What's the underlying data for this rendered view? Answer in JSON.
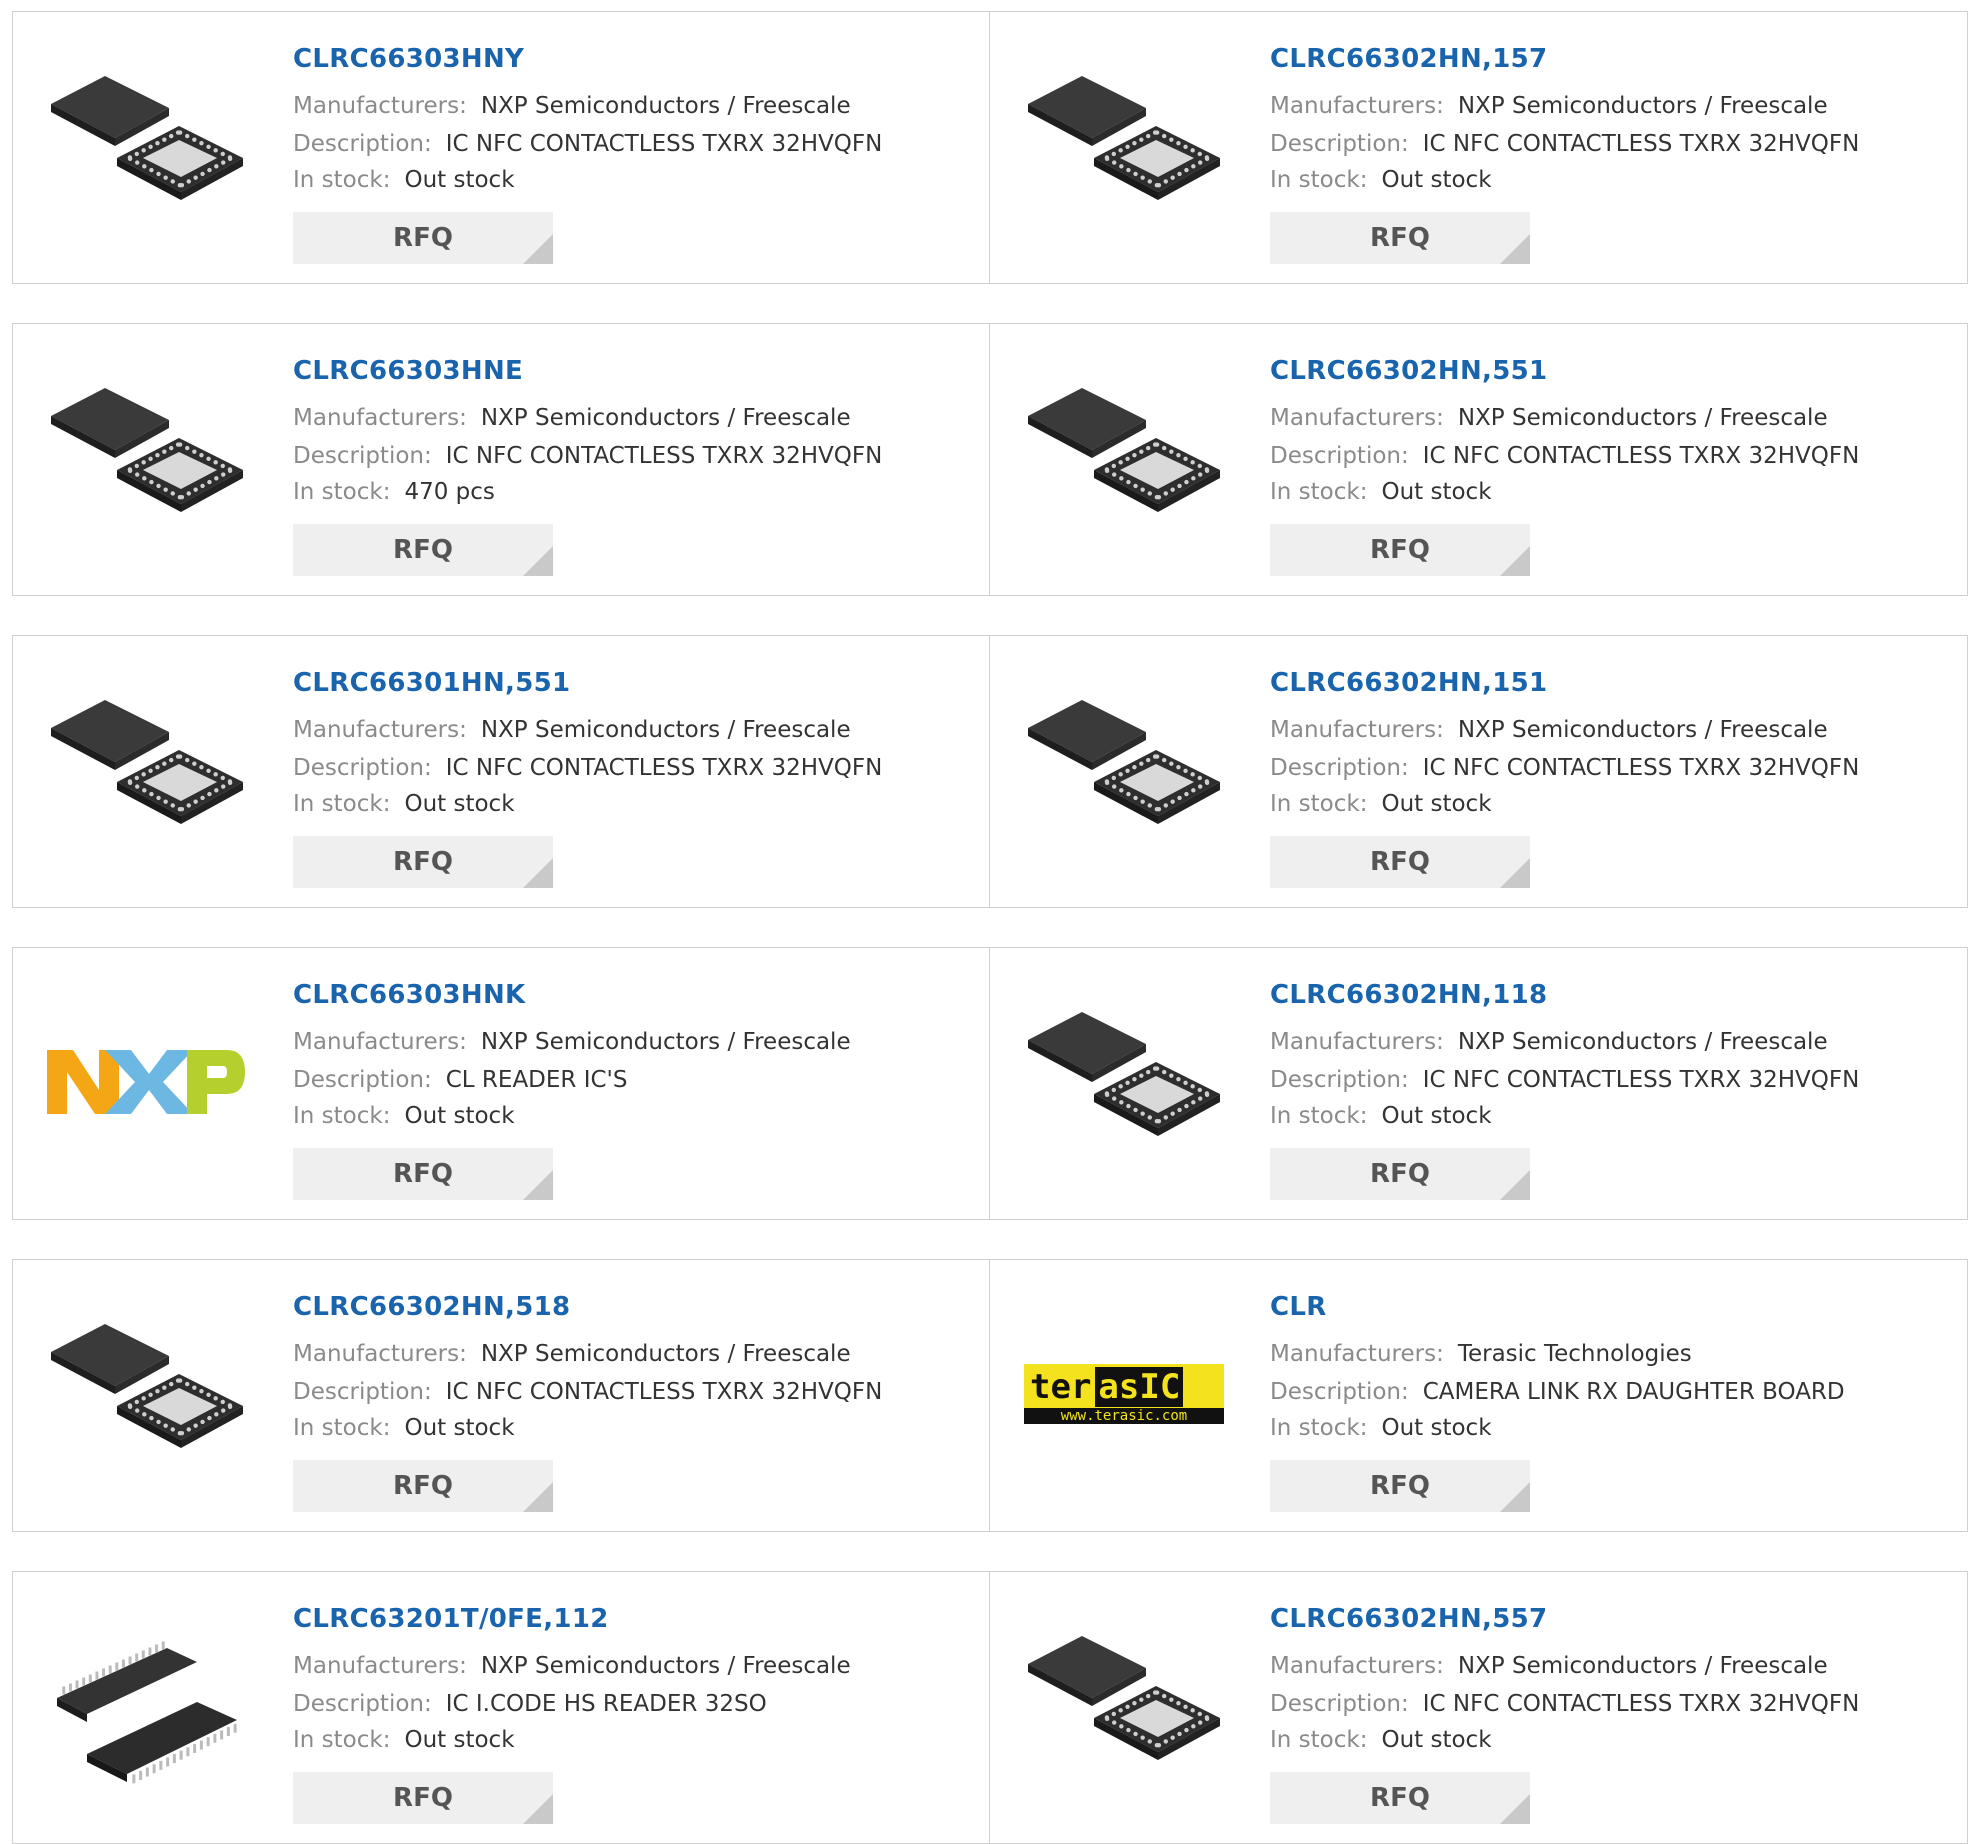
{
  "labels": {
    "manufacturers": "Manufacturers:",
    "description": "Description:",
    "in_stock": "In stock:",
    "rfq": "RFQ"
  },
  "products": [
    {
      "part": "CLRC66303HNY",
      "manufacturer": "NXP Semiconductors / Freescale",
      "description": "IC NFC CONTACTLESS TXRX 32HVQFN",
      "stock": "Out stock",
      "image": "qfn-chip-icon"
    },
    {
      "part": "CLRC66302HN,157",
      "manufacturer": "NXP Semiconductors / Freescale",
      "description": "IC NFC CONTACTLESS TXRX 32HVQFN",
      "stock": "Out stock",
      "image": "qfn-chip-icon"
    },
    {
      "part": "CLRC66303HNE",
      "manufacturer": "NXP Semiconductors / Freescale",
      "description": "IC NFC CONTACTLESS TXRX 32HVQFN",
      "stock": "470 pcs",
      "image": "qfn-chip-icon"
    },
    {
      "part": "CLRC66302HN,551",
      "manufacturer": "NXP Semiconductors / Freescale",
      "description": "IC NFC CONTACTLESS TXRX 32HVQFN",
      "stock": "Out stock",
      "image": "qfn-chip-icon"
    },
    {
      "part": "CLRC66301HN,551",
      "manufacturer": "NXP Semiconductors / Freescale",
      "description": "IC NFC CONTACTLESS TXRX 32HVQFN",
      "stock": "Out stock",
      "image": "qfn-chip-icon"
    },
    {
      "part": "CLRC66302HN,151",
      "manufacturer": "NXP Semiconductors / Freescale",
      "description": "IC NFC CONTACTLESS TXRX 32HVQFN",
      "stock": "Out stock",
      "image": "qfn-chip-icon"
    },
    {
      "part": "CLRC66303HNK",
      "manufacturer": "NXP Semiconductors / Freescale",
      "description": "CL READER IC'S",
      "stock": "Out stock",
      "image": "nxp-logo"
    },
    {
      "part": "CLRC66302HN,118",
      "manufacturer": "NXP Semiconductors / Freescale",
      "description": "IC NFC CONTACTLESS TXRX 32HVQFN",
      "stock": "Out stock",
      "image": "qfn-chip-icon"
    },
    {
      "part": "CLRC66302HN,518",
      "manufacturer": "NXP Semiconductors / Freescale",
      "description": "IC NFC CONTACTLESS TXRX 32HVQFN",
      "stock": "Out stock",
      "image": "qfn-chip-icon"
    },
    {
      "part": "CLR",
      "manufacturer": "Terasic Technologies",
      "description": "CAMERA LINK RX DAUGHTER BOARD",
      "stock": "Out stock",
      "image": "terasic-logo",
      "logo_text": [
        "ter",
        "asIC",
        "www.terasic.com"
      ]
    },
    {
      "part": "CLRC63201T/0FE,112",
      "manufacturer": "NXP Semiconductors / Freescale",
      "description": "IC I.CODE HS READER 32SO",
      "stock": "Out stock",
      "image": "soic-chip-icon"
    },
    {
      "part": "CLRC66302HN,557",
      "manufacturer": "NXP Semiconductors / Freescale",
      "description": "IC NFC CONTACTLESS TXRX 32HVQFN",
      "stock": "Out stock",
      "image": "qfn-chip-icon"
    }
  ],
  "colors": {
    "part_link": "#1a63ad",
    "label": "#8a8a8a",
    "border": "#d0d0d0",
    "rfq_bg": "#efefef",
    "nxp_orange": "#f4a614",
    "nxp_blue": "#6db8e3",
    "nxp_green": "#b5cf2c",
    "terasic_yellow": "#f3e21d"
  }
}
